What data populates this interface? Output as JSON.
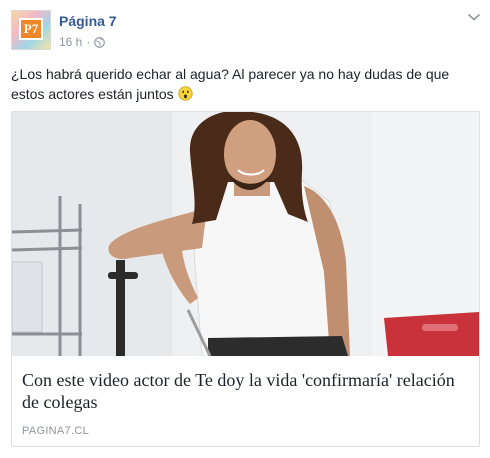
{
  "post": {
    "page_name": "Página 7",
    "avatar_text": "P7",
    "time": "16 h",
    "separator": "·",
    "privacy_icon": "globe-icon",
    "menu_icon": "chevron-down-icon",
    "caption": "¿Los habrá querido echar al agua? Al parecer ya no hay dudas de que estos actores están juntos",
    "caption_emoji": "surprised-face-icon"
  },
  "link_card": {
    "title": "Con este video actor de Te doy la vida 'confirmaría' relación de colegas",
    "domain": "PAGINA7.CL"
  },
  "colors": {
    "link_blue": "#365899",
    "meta_gray": "#90949c",
    "text": "#1d2129",
    "border": "#dddfe2"
  }
}
